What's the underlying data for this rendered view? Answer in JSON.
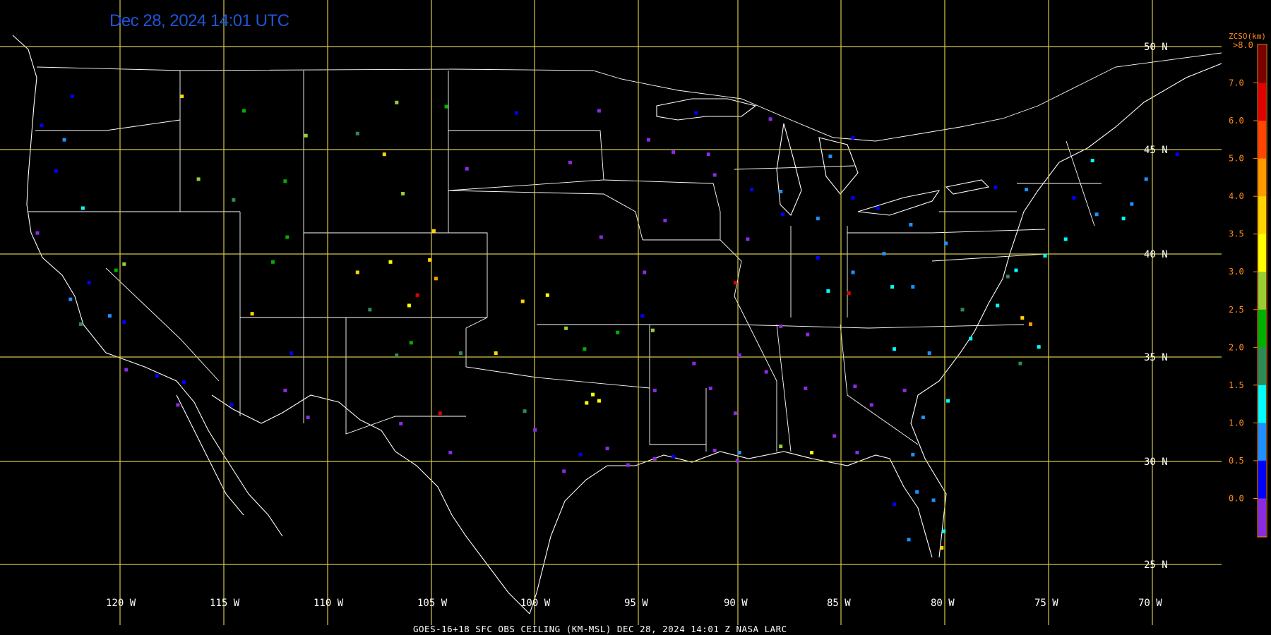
{
  "title": "Dec 28, 2024 14:01 UTC",
  "footer": "GOES-16+18  SFC OBS CEILING (KM-MSL)   DEC 28, 2024 14:01 Z   NASA LARC",
  "map": {
    "lat_labels": [
      "50 N",
      "45 N",
      "40 N",
      "35 N",
      "30 N",
      "25 N"
    ],
    "lon_labels": [
      "120 W",
      "115 W",
      "110 W",
      "105 W",
      "100 W",
      "95 W",
      "90 W",
      "85 W",
      "80 W",
      "75 W",
      "70 W"
    ],
    "grid_color": "#d4c84a"
  },
  "legend": {
    "title": "ZCSO(km)",
    "top_label": ">8.0",
    "ticks": [
      "7.0",
      "6.0",
      "5.0",
      "4.0",
      "3.5",
      "3.0",
      "2.5",
      "2.0",
      "1.5",
      "1.0",
      "0.5",
      "0.0"
    ],
    "colors": [
      "#7b0000",
      "#e00000",
      "#ff4500",
      "#ff9a00",
      "#ffd400",
      "#ffff00",
      "#9acd32",
      "#00b000",
      "#2e8b57",
      "#00ffff",
      "#1e90ff",
      "#0000ff",
      "#8a2be2"
    ]
  },
  "chart_data": {
    "type": "scatter",
    "lon_range": [
      -125,
      -67
    ],
    "lat_range": [
      24,
      51
    ],
    "color_scale_km": [
      0.0,
      0.5,
      1.0,
      1.5,
      2.0,
      2.5,
      3.0,
      3.5,
      4.0,
      5.0,
      6.0,
      7.0,
      8.0
    ],
    "points": [
      [
        -122.3,
        47.6,
        0.8
      ],
      [
        -122.7,
        45.5,
        1.2
      ],
      [
        -123.1,
        44.0,
        0.9
      ],
      [
        -121.8,
        42.2,
        1.5
      ],
      [
        -123.8,
        46.2,
        0.6
      ],
      [
        -124.0,
        41.0,
        0.4
      ],
      [
        -122.4,
        37.8,
        1.1
      ],
      [
        -121.5,
        38.6,
        0.7
      ],
      [
        -120.5,
        37.0,
        1.4
      ],
      [
        -119.8,
        36.7,
        0.9
      ],
      [
        -118.2,
        34.1,
        0.6
      ],
      [
        -117.2,
        32.7,
        0.4
      ],
      [
        -116.9,
        33.8,
        0.5
      ],
      [
        -119.7,
        34.4,
        0.3
      ],
      [
        -121.9,
        36.6,
        2.2
      ],
      [
        -120.2,
        39.2,
        2.6
      ],
      [
        -119.8,
        39.5,
        3.0
      ],
      [
        -117.0,
        47.6,
        4.1
      ],
      [
        -116.2,
        43.6,
        3.1
      ],
      [
        -114.5,
        42.6,
        2.4
      ],
      [
        -112.0,
        43.5,
        2.8
      ],
      [
        -111.9,
        40.8,
        2.9
      ],
      [
        -112.6,
        39.6,
        2.6
      ],
      [
        -113.6,
        37.1,
        4.6
      ],
      [
        -114.0,
        46.9,
        2.7
      ],
      [
        -111.0,
        45.7,
        3.4
      ],
      [
        -108.5,
        45.8,
        2.2
      ],
      [
        -106.6,
        47.3,
        3.2
      ],
      [
        -104.2,
        47.1,
        2.5
      ],
      [
        -107.2,
        44.8,
        4.9
      ],
      [
        -106.3,
        42.9,
        3.0
      ],
      [
        -104.8,
        41.1,
        4.2
      ],
      [
        -105.0,
        39.7,
        4.7
      ],
      [
        -104.7,
        38.8,
        5.1
      ],
      [
        -106.0,
        37.5,
        3.5
      ],
      [
        -107.9,
        37.3,
        2.1
      ],
      [
        -108.5,
        39.1,
        4.3
      ],
      [
        -106.9,
        39.6,
        3.9
      ],
      [
        -105.6,
        38.0,
        7.8
      ],
      [
        -103.5,
        35.2,
        2.3
      ],
      [
        -105.9,
        35.7,
        2.6
      ],
      [
        -106.6,
        35.1,
        2.4
      ],
      [
        -104.5,
        32.3,
        7.4
      ],
      [
        -101.8,
        35.2,
        4.0
      ],
      [
        -100.5,
        37.7,
        4.3
      ],
      [
        -99.3,
        38.0,
        3.9
      ],
      [
        -98.4,
        36.4,
        3.0
      ],
      [
        -97.5,
        35.4,
        2.8
      ],
      [
        -97.4,
        32.8,
        3.6
      ],
      [
        -96.8,
        32.9,
        3.7
      ],
      [
        -97.1,
        33.2,
        3.9
      ],
      [
        -98.5,
        29.5,
        0.4
      ],
      [
        -95.4,
        29.8,
        0.3
      ],
      [
        -97.7,
        30.3,
        0.5
      ],
      [
        -94.1,
        30.1,
        0.4
      ],
      [
        -93.2,
        30.2,
        0.6
      ],
      [
        -91.2,
        30.5,
        0.3
      ],
      [
        -90.1,
        30.0,
        0.4
      ],
      [
        -88.0,
        30.7,
        3.2
      ],
      [
        -86.5,
        30.4,
        3.9
      ],
      [
        -84.3,
        30.4,
        0.4
      ],
      [
        -82.5,
        27.9,
        0.8
      ],
      [
        -81.4,
        28.5,
        1.2
      ],
      [
        -80.2,
        25.8,
        4.0
      ],
      [
        -80.1,
        26.6,
        1.6
      ],
      [
        -81.6,
        30.3,
        1.4
      ],
      [
        -84.4,
        33.6,
        0.3
      ],
      [
        -86.8,
        33.5,
        0.4
      ],
      [
        -90.2,
        32.3,
        0.3
      ],
      [
        -92.2,
        34.7,
        0.4
      ],
      [
        -94.6,
        39.1,
        0.3
      ],
      [
        -93.6,
        41.6,
        0.4
      ],
      [
        -93.2,
        44.9,
        0.4
      ],
      [
        -96.7,
        40.8,
        0.3
      ],
      [
        -91.5,
        44.8,
        0.3
      ],
      [
        -88.0,
        43.0,
        1.0
      ],
      [
        -87.9,
        41.9,
        0.8
      ],
      [
        -86.2,
        39.8,
        0.9
      ],
      [
        -84.5,
        39.1,
        1.1
      ],
      [
        -83.0,
        40.0,
        1.3
      ],
      [
        -81.7,
        41.4,
        1.2
      ],
      [
        -80.0,
        40.5,
        1.4
      ],
      [
        -77.6,
        43.2,
        0.9
      ],
      [
        -76.1,
        43.1,
        1.0
      ],
      [
        -73.8,
        42.7,
        0.8
      ],
      [
        -71.0,
        42.4,
        1.1
      ],
      [
        -72.7,
        41.9,
        1.4
      ],
      [
        -74.2,
        40.7,
        1.6
      ],
      [
        -75.2,
        39.9,
        1.5
      ],
      [
        -76.6,
        39.2,
        1.8
      ],
      [
        -77.0,
        38.9,
        2.0
      ],
      [
        -77.5,
        37.5,
        1.6
      ],
      [
        -76.3,
        36.9,
        4.8
      ],
      [
        -75.9,
        36.6,
        5.6
      ],
      [
        -78.8,
        35.9,
        1.5
      ],
      [
        -80.8,
        35.2,
        1.4
      ],
      [
        -82.5,
        35.4,
        1.9
      ],
      [
        -79.9,
        32.9,
        1.7
      ],
      [
        -81.1,
        32.1,
        1.2
      ],
      [
        -84.5,
        42.7,
        0.8
      ],
      [
        -85.6,
        44.7,
        1.4
      ],
      [
        -83.3,
        42.2,
        0.9
      ],
      [
        -86.2,
        41.7,
        1.1
      ],
      [
        -89.4,
        43.1,
        0.5
      ],
      [
        -90.2,
        38.6,
        7.8
      ],
      [
        -84.7,
        38.1,
        7.9
      ],
      [
        -85.7,
        38.2,
        1.5
      ],
      [
        -86.7,
        36.1,
        0.4
      ],
      [
        -90.0,
        35.1,
        0.3
      ],
      [
        -88.0,
        36.5,
        0.4
      ],
      [
        -82.6,
        38.4,
        1.7
      ],
      [
        -81.6,
        38.4,
        1.3
      ],
      [
        -79.2,
        37.3,
        2.3
      ],
      [
        -75.5,
        35.5,
        1.9
      ],
      [
        -76.4,
        34.7,
        2.2
      ],
      [
        -96.8,
        46.9,
        0.4
      ],
      [
        -100.8,
        46.8,
        0.5
      ],
      [
        -98.2,
        44.4,
        0.3
      ],
      [
        -103.2,
        44.1,
        0.4
      ],
      [
        -84.5,
        45.6,
        0.8
      ],
      [
        -88.5,
        46.5,
        0.4
      ],
      [
        -92.1,
        46.8,
        0.6
      ],
      [
        -70.3,
        43.6,
        1.2
      ],
      [
        -68.8,
        44.8,
        0.9
      ],
      [
        -72.9,
        44.5,
        1.5
      ],
      [
        -71.4,
        41.7,
        1.7
      ],
      [
        -83.6,
        32.7,
        0.3
      ],
      [
        -82.0,
        33.4,
        0.4
      ],
      [
        -85.4,
        31.2,
        0.3
      ],
      [
        -88.7,
        34.3,
        0.4
      ],
      [
        -91.4,
        33.5,
        0.3
      ],
      [
        -94.1,
        33.4,
        0.3
      ],
      [
        -96.4,
        30.6,
        0.4
      ],
      [
        -99.9,
        31.5,
        0.3
      ],
      [
        -100.4,
        32.4,
        2.2
      ],
      [
        -94.7,
        37.0,
        0.5
      ],
      [
        -95.9,
        36.2,
        2.6
      ],
      [
        -94.2,
        36.3,
        3.3
      ],
      [
        -89.6,
        40.7,
        0.3
      ],
      [
        -91.2,
        43.8,
        0.3
      ],
      [
        -94.4,
        45.5,
        0.4
      ],
      [
        -90.0,
        30.4,
        1.4
      ],
      [
        -80.6,
        28.1,
        1.3
      ],
      [
        -81.8,
        26.2,
        1.2
      ],
      [
        -104.0,
        30.4,
        0.4
      ],
      [
        -106.4,
        31.8,
        0.3
      ],
      [
        -112.0,
        33.4,
        0.3
      ],
      [
        -110.9,
        32.1,
        0.4
      ],
      [
        -114.6,
        32.7,
        0.6
      ],
      [
        -111.7,
        35.2,
        0.5
      ]
    ]
  }
}
